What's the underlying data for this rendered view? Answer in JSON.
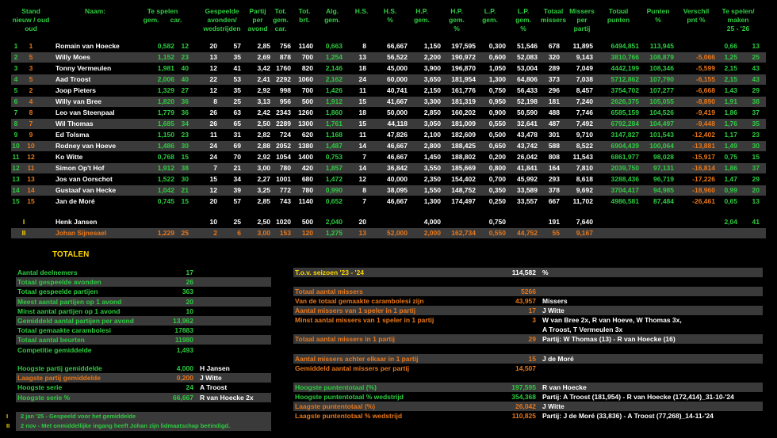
{
  "headers": {
    "stand": "Stand",
    "nieuw_oud": "nieuw / oud",
    "naam": "Naam:",
    "te_spelen": "Te spelen",
    "gem": "gem.",
    "car": "car.",
    "gespeelde": "Gespeelde",
    "avonden": "avonden/",
    "wedstrijden": "wedstrijden",
    "partij": "Partij",
    "per": "per",
    "avond": "avond",
    "tot": "Tot.",
    "gem2": "gem.",
    "car2": "car.",
    "tot_brt": "Tot.",
    "brt": "brt.",
    "alg": "Alg.",
    "alg_gem": "gem.",
    "hs": "H.S.",
    "hspct": "H.S.",
    "hspct2": "%",
    "hp": "H.P.",
    "hp_gem": "gem.",
    "hppct": "H.P.",
    "hppct2": "gem.",
    "hppct3": "%",
    "lp": "L.P.",
    "lp_gem": "gem.",
    "lppct": "L.P.",
    "lppct2": "gem.",
    "lppct3": "%",
    "totaal": "Totaal",
    "missers": "missers",
    "missers_per": "Missers",
    "per2": "per",
    "partij2": "partij",
    "totaal_punten": "Totaal",
    "punten": "punten",
    "punten_pct": "Punten",
    "pct": "%",
    "verschil": "Verschil",
    "pnt_pct": "pnt %",
    "te_spelen_maken": "Te spelen/",
    "maken": "maken",
    "season": "25 - '26"
  },
  "rows": [
    {
      "n": "1",
      "o": "1",
      "naam": "Romain van Hoecke",
      "gem": "0,582",
      "car": "12",
      "av": "20",
      "wd": "57",
      "ppa": "2,85",
      "tgem": "756",
      "tcar": "1140",
      "brt": "0,663",
      "alg": "8",
      "hs": "66,667",
      "hspct": "1,150",
      "hp": "197,595",
      "hppct": "0,300",
      "lp": "51,546",
      "lppct": "678",
      "mis": "11,895",
      "misp": "6494,851",
      "punt": "113,945",
      "pct": "",
      "ver": "0,66",
      "ts": "13"
    },
    {
      "n": "2",
      "o": "5",
      "naam": "Willy Moes",
      "gem": "1,152",
      "car": "23",
      "av": "13",
      "wd": "35",
      "ppa": "2,69",
      "tgem": "878",
      "tcar": "700",
      "brt": "1,254",
      "alg": "13",
      "hs": "56,522",
      "hspct": "2,200",
      "hp": "190,972",
      "hppct": "0,600",
      "lp": "52,083",
      "lppct": "320",
      "mis": "9,143",
      "misp": "3810,766",
      "punt": "108,879",
      "pct": "-5,066",
      "ver": "1,25",
      "ts": "25"
    },
    {
      "n": "3",
      "o": "3",
      "naam": "Tonny Vermeulen",
      "gem": "1,981",
      "car": "40",
      "av": "12",
      "wd": "41",
      "ppa": "3,42",
      "tgem": "1760",
      "tcar": "820",
      "brt": "2,146",
      "alg": "18",
      "hs": "45,000",
      "hspct": "3,900",
      "hp": "196,870",
      "hppct": "1,050",
      "lp": "53,004",
      "lppct": "289",
      "mis": "7,049",
      "misp": "4442,199",
      "punt": "108,346",
      "pct": "-5,599",
      "ver": "2,15",
      "ts": "43"
    },
    {
      "n": "4",
      "o": "5",
      "naam": "Aad Troost",
      "gem": "2,006",
      "car": "40",
      "av": "22",
      "wd": "53",
      "ppa": "2,41",
      "tgem": "2292",
      "tcar": "1060",
      "brt": "2,162",
      "alg": "24",
      "hs": "60,000",
      "hspct": "3,650",
      "hp": "181,954",
      "hppct": "1,300",
      "lp": "64,806",
      "lppct": "373",
      "mis": "7,038",
      "misp": "5712,862",
      "punt": "107,790",
      "pct": "-6,155",
      "ver": "2,15",
      "ts": "43"
    },
    {
      "n": "5",
      "o": "2",
      "naam": "Joop Pieters",
      "gem": "1,329",
      "car": "27",
      "av": "12",
      "wd": "35",
      "ppa": "2,92",
      "tgem": "998",
      "tcar": "700",
      "brt": "1,426",
      "alg": "11",
      "hs": "40,741",
      "hspct": "2,150",
      "hp": "161,776",
      "hppct": "0,750",
      "lp": "56,433",
      "lppct": "296",
      "mis": "8,457",
      "misp": "3754,702",
      "punt": "107,277",
      "pct": "-6,668",
      "ver": "1,43",
      "ts": "29"
    },
    {
      "n": "6",
      "o": "4",
      "naam": "Willy van Bree",
      "gem": "1,820",
      "car": "36",
      "av": "8",
      "wd": "25",
      "ppa": "3,13",
      "tgem": "956",
      "tcar": "500",
      "brt": "1,912",
      "alg": "15",
      "hs": "41,667",
      "hspct": "3,300",
      "hp": "181,319",
      "hppct": "0,950",
      "lp": "52,198",
      "lppct": "181",
      "mis": "7,240",
      "misp": "2626,375",
      "punt": "105,055",
      "pct": "-8,890",
      "ver": "1,91",
      "ts": "38"
    },
    {
      "n": "7",
      "o": "8",
      "naam": "Leo van Steenpaal",
      "gem": "1,779",
      "car": "36",
      "av": "26",
      "wd": "63",
      "ppa": "2,42",
      "tgem": "2343",
      "tcar": "1260",
      "brt": "1,860",
      "alg": "18",
      "hs": "50,000",
      "hspct": "2,850",
      "hp": "160,202",
      "hppct": "0,900",
      "lp": "50,590",
      "lppct": "488",
      "mis": "7,746",
      "misp": "6585,159",
      "punt": "104,526",
      "pct": "-9,419",
      "ver": "1,86",
      "ts": "37"
    },
    {
      "n": "8",
      "o": "7",
      "naam": "Wil Thomas",
      "gem": "1,685",
      "car": "34",
      "av": "26",
      "wd": "65",
      "ppa": "2,50",
      "tgem": "2289",
      "tcar": "1300",
      "brt": "1,761",
      "alg": "15",
      "hs": "44,118",
      "hspct": "3,050",
      "hp": "181,009",
      "hppct": "0,550",
      "lp": "32,641",
      "lppct": "487",
      "mis": "7,492",
      "misp": "6792,284",
      "punt": "104,497",
      "pct": "-9,448",
      "ver": "1,76",
      "ts": "35"
    },
    {
      "n": "9",
      "o": "9",
      "naam": "Ed Tolsma",
      "gem": "1,150",
      "car": "23",
      "av": "11",
      "wd": "31",
      "ppa": "2,82",
      "tgem": "724",
      "tcar": "620",
      "brt": "1,168",
      "alg": "11",
      "hs": "47,826",
      "hspct": "2,100",
      "hp": "182,609",
      "hppct": "0,500",
      "lp": "43,478",
      "lppct": "301",
      "mis": "9,710",
      "misp": "3147,827",
      "punt": "101,543",
      "pct": "-12,402",
      "ver": "1,17",
      "ts": "23"
    },
    {
      "n": "10",
      "o": "10",
      "naam": "Rodney van Hoeve",
      "gem": "1,486",
      "car": "30",
      "av": "24",
      "wd": "69",
      "ppa": "2,88",
      "tgem": "2052",
      "tcar": "1380",
      "brt": "1,487",
      "alg": "14",
      "hs": "46,667",
      "hspct": "2,800",
      "hp": "188,425",
      "hppct": "0,650",
      "lp": "43,742",
      "lppct": "588",
      "mis": "8,522",
      "misp": "6904,439",
      "punt": "100,064",
      "pct": "-13,881",
      "ver": "1,49",
      "ts": "30"
    },
    {
      "n": "11",
      "o": "12",
      "naam": "Ko Witte",
      "gem": "0,768",
      "car": "15",
      "av": "24",
      "wd": "70",
      "ppa": "2,92",
      "tgem": "1054",
      "tcar": "1400",
      "brt": "0,753",
      "alg": "7",
      "hs": "46,667",
      "hspct": "1,450",
      "hp": "188,802",
      "hppct": "0,200",
      "lp": "26,042",
      "lppct": "808",
      "mis": "11,543",
      "misp": "6861,977",
      "punt": "98,028",
      "pct": "-15,917",
      "ver": "0,75",
      "ts": "15"
    },
    {
      "n": "12",
      "o": "11",
      "naam": "Simon Op't Hof",
      "gem": "1,912",
      "car": "38",
      "av": "7",
      "wd": "21",
      "ppa": "3,00",
      "tgem": "780",
      "tcar": "420",
      "brt": "1,857",
      "alg": "14",
      "hs": "36,842",
      "hspct": "3,550",
      "hp": "185,669",
      "hppct": "0,800",
      "lp": "41,841",
      "lppct": "164",
      "mis": "7,810",
      "misp": "2039,750",
      "punt": "97,131",
      "pct": "-16,814",
      "ver": "1,86",
      "ts": "37"
    },
    {
      "n": "13",
      "o": "13",
      "naam": "Jos van Oorschot",
      "gem": "1,522",
      "car": "30",
      "av": "15",
      "wd": "34",
      "ppa": "2,27",
      "tgem": "1001",
      "tcar": "680",
      "brt": "1,472",
      "alg": "12",
      "hs": "40,000",
      "hspct": "2,350",
      "hp": "154,402",
      "hppct": "0,700",
      "lp": "45,992",
      "lppct": "293",
      "mis": "8,618",
      "misp": "3288,436",
      "punt": "96,719",
      "pct": "-17,226",
      "ver": "1,47",
      "ts": "29"
    },
    {
      "n": "14",
      "o": "14",
      "naam": "Gustaaf van Hecke",
      "gem": "1,042",
      "car": "21",
      "av": "12",
      "wd": "39",
      "ppa": "3,25",
      "tgem": "772",
      "tcar": "780",
      "brt": "0,990",
      "alg": "8",
      "hs": "38,095",
      "hspct": "1,550",
      "hp": "148,752",
      "hppct": "0,350",
      "lp": "33,589",
      "lppct": "378",
      "mis": "9,692",
      "misp": "3704,417",
      "punt": "94,985",
      "pct": "-18,960",
      "ver": "0,99",
      "ts": "20"
    },
    {
      "n": "15",
      "o": "15",
      "naam": "Jan de Moré",
      "gem": "0,745",
      "car": "15",
      "av": "20",
      "wd": "57",
      "ppa": "2,85",
      "tgem": "743",
      "tcar": "1140",
      "brt": "0,652",
      "alg": "7",
      "hs": "46,667",
      "hspct": "1,300",
      "hp": "174,497",
      "hppct": "0,250",
      "lp": "33,557",
      "lppct": "667",
      "mis": "11,702",
      "misp": "4986,581",
      "punt": "87,484",
      "pct": "-26,461",
      "ver": "0,65",
      "ts": "13"
    }
  ],
  "extra": [
    {
      "n": "I",
      "naam": "Henk Jansen",
      "gem": "",
      "car": "",
      "av": "10",
      "wd": "25",
      "ppa": "2,50",
      "tgem": "1020",
      "tcar": "500",
      "brt": "2,040",
      "alg": "20",
      "hs": "",
      "hspct": "4,000",
      "hp": "",
      "hppct": "0,750",
      "lp": "",
      "lppct": "191",
      "mis": "7,640",
      "ver": "2,04",
      "ts": "41"
    },
    {
      "n": "II",
      "naam": "Johan Sijnesael",
      "gem": "1,229",
      "car": "25",
      "av": "2",
      "wd": "6",
      "ppa": "3,00",
      "tgem": "153",
      "tcar": "120",
      "brt": "1,275",
      "alg": "13",
      "hs": "52,000",
      "hspct": "2,000",
      "hp": "162,734",
      "hppct": "0,550",
      "lp": "44,752",
      "lppct": "55",
      "mis": "9,167",
      "ver": "",
      "ts": ""
    }
  ],
  "totalen_title": "TOTALEN",
  "left_stats": [
    {
      "label": "Aantal deelnemers",
      "value": "17",
      "extra": ""
    },
    {
      "label": "Totaal gespeelde avonden",
      "value": "26",
      "extra": ""
    },
    {
      "label": "Totaal gespeelde partijen",
      "value": "363",
      "extra": ""
    },
    {
      "label": "Meest aantal partijen op 1 avond",
      "value": "20",
      "extra": ""
    },
    {
      "label": "Minst aantal partijen op 1 avond",
      "value": "10",
      "extra": ""
    },
    {
      "label": "Gemiddeld aantal partijen per avond",
      "value": "13,962",
      "extra": ""
    },
    {
      "label": "Totaal gemaakte carambolesi",
      "value": "17883",
      "extra": ""
    },
    {
      "label": "Totaal aantal beurten",
      "value": "11980",
      "extra": ""
    },
    {
      "label": "Competitie gemiddelde",
      "value": "1,493",
      "extra": ""
    }
  ],
  "left_stats2": [
    {
      "label": "Hoogste partij gemiddelde",
      "value": "4,000",
      "extra": "H Jansen",
      "color": "g"
    },
    {
      "label": "Laagste partij gemiddelde",
      "value": "0,200",
      "extra": "J Witte",
      "color": "o"
    },
    {
      "label": "Hoogste serie",
      "value": "24",
      "extra": "A Troost",
      "color": "g"
    },
    {
      "label": "Hoogste serie %",
      "value": "66,667",
      "extra": "R van Hoecke 2x",
      "color": "g"
    }
  ],
  "right_stats": {
    "tov_label": "T.o.v. seizoen '23 - '24",
    "tov_value": "114,582",
    "tov_unit": "%",
    "missers_label": "Totaal aantal missers",
    "missers_value": "5266",
    "van_label": "Van de totaal gemaakte carambolesi zijn",
    "van_value": "43,957",
    "van_extra": "Missers",
    "meest_label": "Aantal missers van 1 speler in 1 partij",
    "meest_value": "17",
    "meest_extra": "J Witte",
    "minst_label": "Minst aantal missers van 1 speler in 1 partij",
    "minst_value": "3",
    "minst_extra1": "W van Bree 2x, R van Hoeve, W Thomas 3x,",
    "minst_extra2": "A Troost, T Vermeulen 3x",
    "partij_label": "Totaal aantal missers in 1 partij",
    "partij_value": "29",
    "partij_extra": "Partij: W Thomas (13) - R van Hoecke (16)",
    "achter_label": "Aantal missers achter elkaar in 1 partij",
    "achter_value": "15",
    "achter_extra": "J de Moré",
    "gem_label": "Gemiddeld aantal missers per partij",
    "gem_value": "14,507",
    "hp_label": "Hoogste puntentotaal (%)",
    "hp_value": "197,595",
    "hp_extra": "R van Hoecke",
    "hpw_label": "Hoogste puntentotaal % wedstrijd",
    "hpw_value": "354,368",
    "hpw_extra": "Partij: A Troost (181,954) - R van Hoecke (172,414)_31-10-'24",
    "lp_label": "Laagste puntentotaal (%)",
    "lp_value": "26,042",
    "lp_extra": "J Witte",
    "lpw_label": "Laagste puntentotaal % wedstrijd",
    "lpw_value": "110,825",
    "lpw_extra": "Partij: J de Moré (33,836) - A Troost (77,268)_14-11-'24"
  },
  "footnotes": [
    {
      "mark": "I",
      "text": "2 jan '25 - Gespeeld voor het gemiddelde"
    },
    {
      "mark": "II",
      "text": "2 nov - Met onmiddellijke ingang heeft Johan zijn lidmaatschap beëindigd."
    }
  ]
}
